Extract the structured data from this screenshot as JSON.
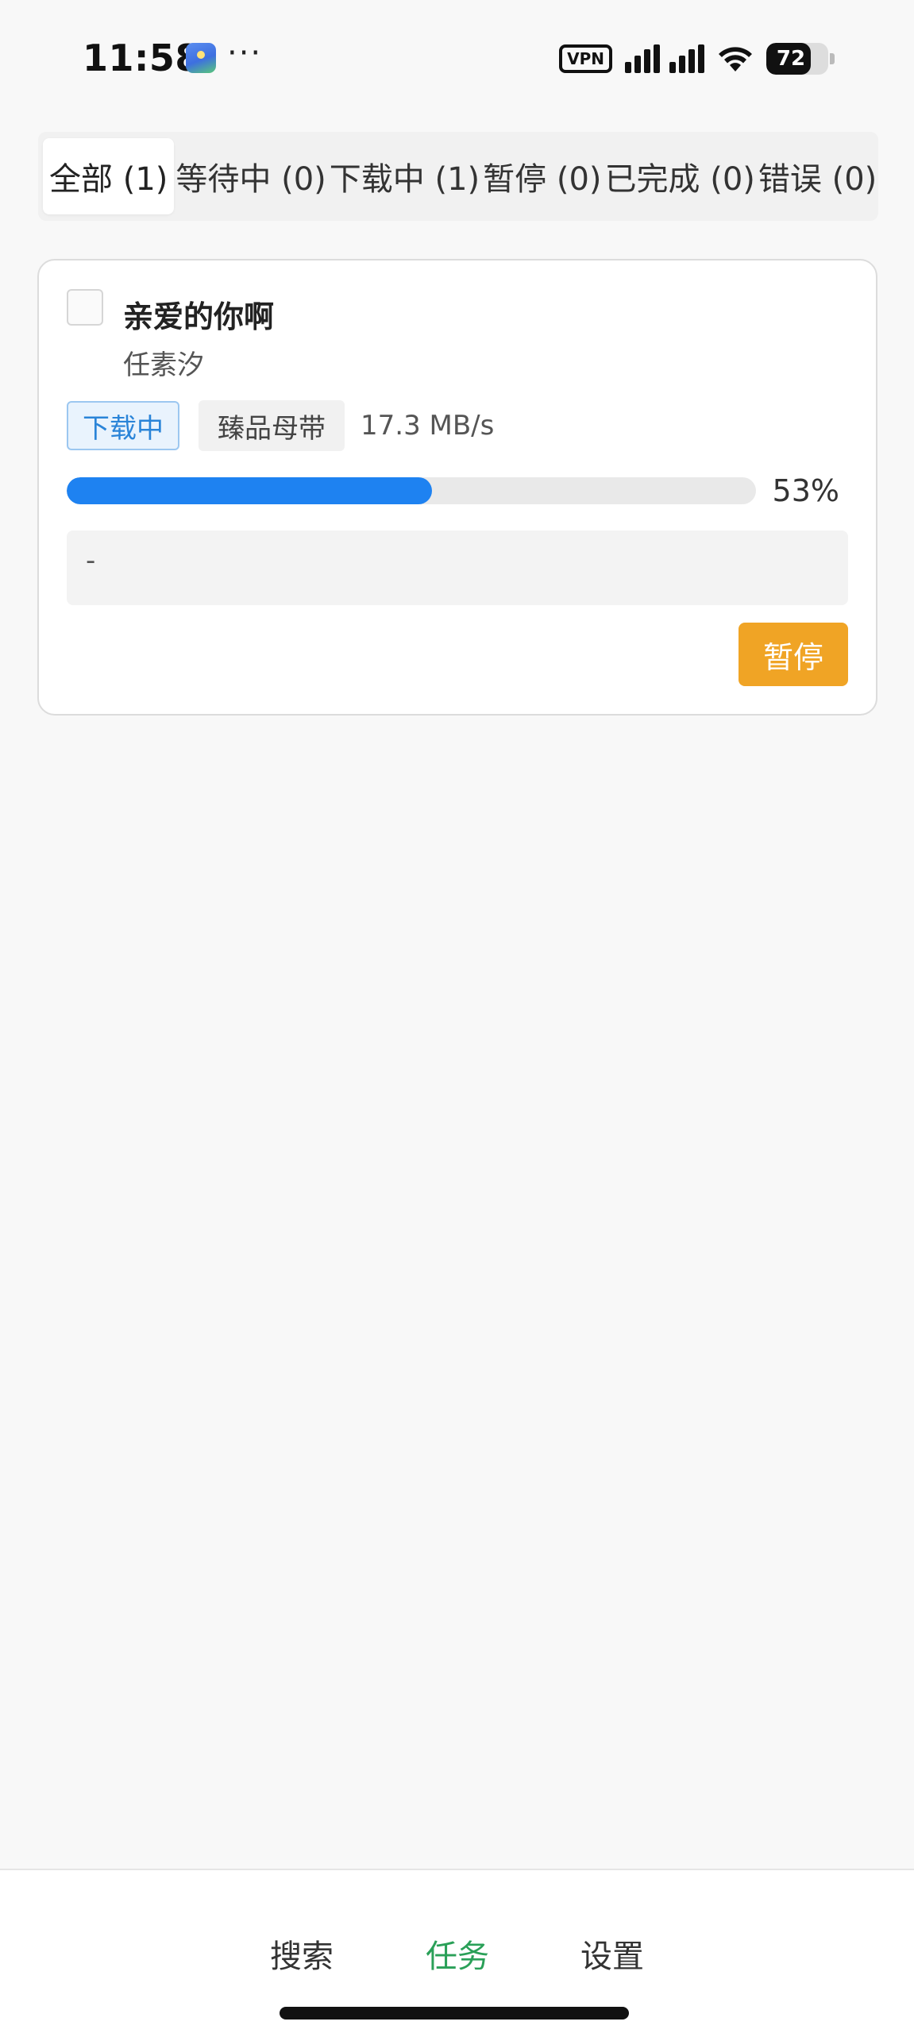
{
  "status_bar": {
    "time": "11:58",
    "app_icon": "gallery-app-icon",
    "more_indicator": "···",
    "vpn_label": "VPN",
    "battery_level": "72",
    "battery_fraction": 0.72
  },
  "tabs": [
    {
      "label": "全部 (1)",
      "active": true
    },
    {
      "label": "等待中 (0)",
      "active": false
    },
    {
      "label": "下载中 (1)",
      "active": false
    },
    {
      "label": "暂停 (0)",
      "active": false
    },
    {
      "label": "已完成 (0)",
      "active": false
    },
    {
      "label": "错误 (0)",
      "active": false
    }
  ],
  "task": {
    "title": "亲爱的你啊",
    "artist": "任素汐",
    "status_tag": "下载中",
    "quality_tag": "臻品母带",
    "speed": "17.3 MB/s",
    "progress_percent": 53,
    "progress_label": "53%",
    "message": "-",
    "pause_label": "暂停",
    "colors": {
      "progress": "#1e82f1",
      "pause_button": "#f0a425",
      "status_tag": "#2a84d8"
    }
  },
  "bottom_nav": {
    "items": [
      {
        "label": "搜索",
        "active": false
      },
      {
        "label": "任务",
        "active": true
      },
      {
        "label": "设置",
        "active": false
      }
    ],
    "active_color": "#2aa058"
  }
}
